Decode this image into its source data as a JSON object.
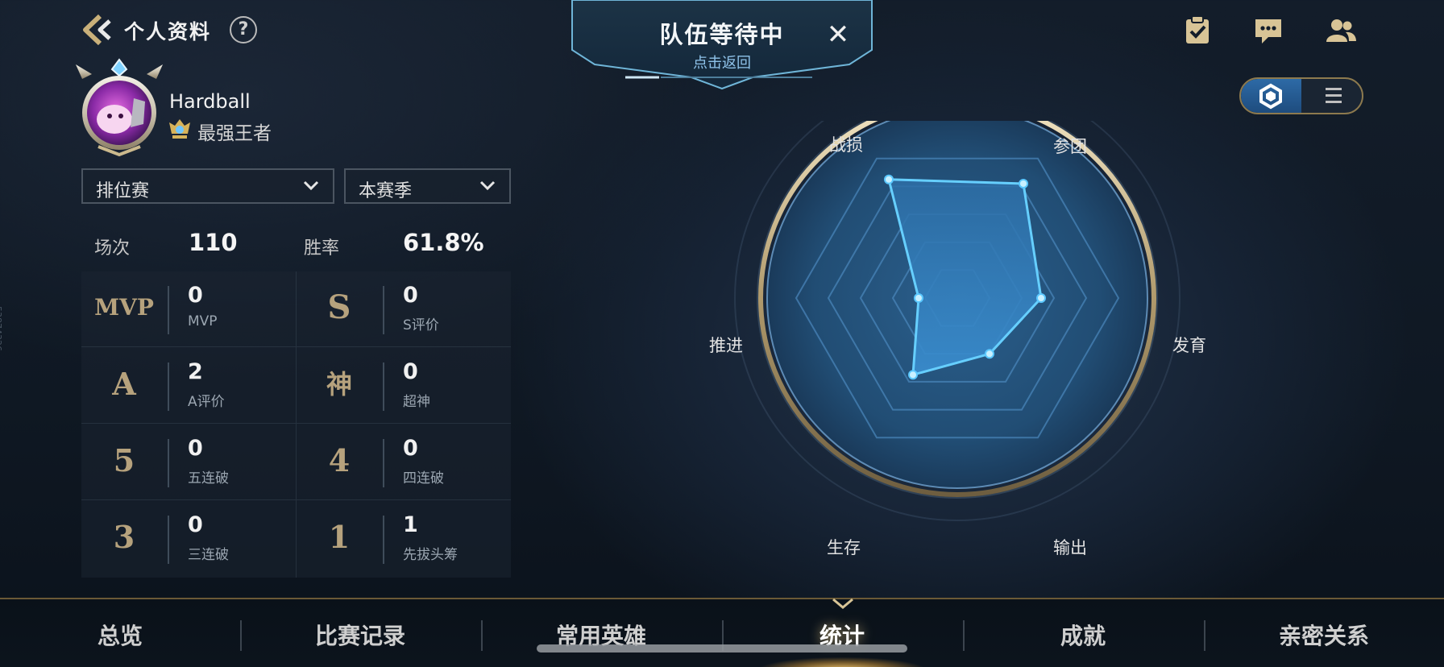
{
  "header": {
    "title": "个人资料",
    "help_symbol": "?"
  },
  "team_banner": {
    "title": "队伍等待中",
    "subtitle": "点击返回",
    "close_symbol": "✕"
  },
  "top_icons": [
    "task-clipboard-icon",
    "chat-message-icon",
    "friends-icon"
  ],
  "view_toggle": {
    "options": [
      "hexagon-radar-icon",
      "list-icon"
    ],
    "selected": "hexagon-radar-icon"
  },
  "profile": {
    "name": "Hardball",
    "rank": "最强王者"
  },
  "filters": {
    "mode": "排位赛",
    "season": "本赛季"
  },
  "summary": {
    "games_label": "场次",
    "games_value": "110",
    "winrate_label": "胜率",
    "winrate_value": "61.8%"
  },
  "stats": [
    {
      "icon": "MVP",
      "value": "0",
      "label": "MVP"
    },
    {
      "icon": "S",
      "value": "0",
      "label": "S评价"
    },
    {
      "icon": "A",
      "value": "2",
      "label": "A评价"
    },
    {
      "icon": "神",
      "value": "0",
      "label": "超神"
    },
    {
      "icon": "5",
      "value": "0",
      "label": "五连破"
    },
    {
      "icon": "4",
      "value": "0",
      "label": "四连破"
    },
    {
      "icon": "3",
      "value": "0",
      "label": "三连破"
    },
    {
      "icon": "1",
      "value": "1",
      "label": "先拔头筹"
    }
  ],
  "side_id": "53874326",
  "radar": {
    "labels": {
      "zhansun": "战损",
      "cantuan": "参团",
      "fayu": "发育",
      "shuchu": "输出",
      "shengcun": "生存",
      "tuijin": "推进"
    },
    "accent": "#5bc8ff"
  },
  "chart_data": {
    "type": "radar",
    "categories": [
      "战损",
      "参团",
      "发育",
      "输出",
      "生存",
      "推进"
    ],
    "values": [
      0.85,
      0.82,
      0.52,
      0.4,
      0.55,
      0.24
    ],
    "range": [
      0,
      1
    ]
  },
  "bottom_nav": {
    "tabs": [
      "总览",
      "比赛记录",
      "常用英雄",
      "统计",
      "成就",
      "亲密关系"
    ],
    "active_index": 3
  }
}
